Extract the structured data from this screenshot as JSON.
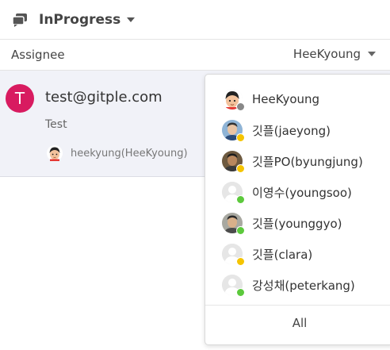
{
  "header": {
    "status_label": "InProgress",
    "icon": "chat-bubbles-icon"
  },
  "filter": {
    "label": "Assignee",
    "selected": "HeeKyoung"
  },
  "conversation": {
    "avatar_letter": "T",
    "avatar_color": "#d81b60",
    "email": "test@gitple.com",
    "message": "Test",
    "assignee": "heekyung(HeeKyoung)"
  },
  "dropdown": {
    "items": [
      {
        "label": "HeeKyoung",
        "status": "away",
        "avatar": "cartoon"
      },
      {
        "label": "깃플(jaeyong)",
        "status": "busy",
        "avatar": "photo"
      },
      {
        "label": "깃플PO(byungjung)",
        "status": "busy",
        "avatar": "photo"
      },
      {
        "label": "이영수(youngsoo)",
        "status": "online",
        "avatar": "default"
      },
      {
        "label": "깃플(younggyo)",
        "status": "online",
        "avatar": "photo"
      },
      {
        "label": "깃플(clara)",
        "status": "busy",
        "avatar": "default"
      },
      {
        "label": "강성채(peterkang)",
        "status": "online",
        "avatar": "default"
      }
    ],
    "all_label": "All"
  },
  "colors": {
    "online": "#5cc93c",
    "busy": "#f5c400",
    "away": "#888888"
  }
}
